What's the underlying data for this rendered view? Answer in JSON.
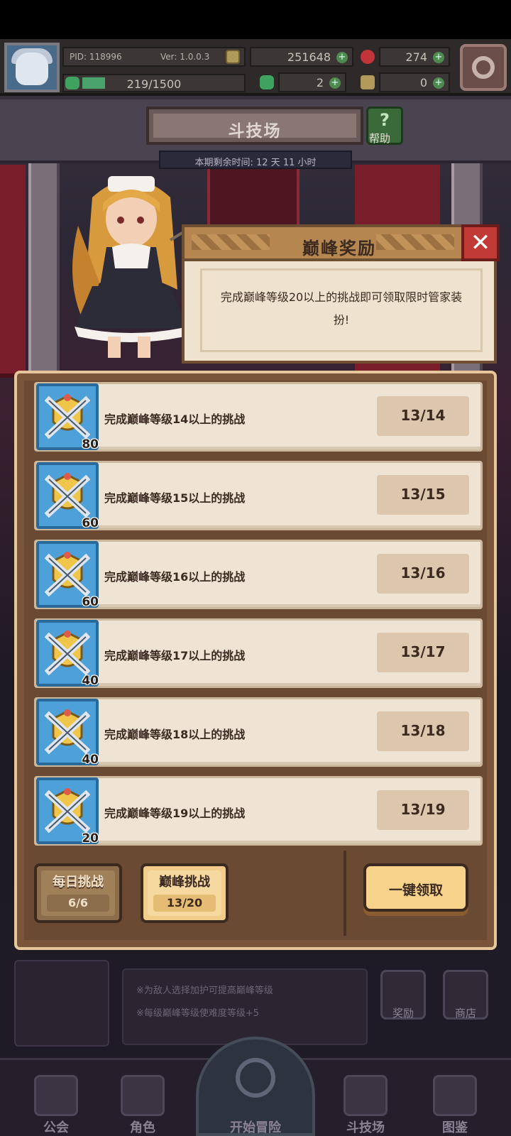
{
  "header": {
    "pid": "PID: 118996",
    "version": "Ver: 1.0.0.3",
    "gold": "251648",
    "gems": "274",
    "energy": "219/1500",
    "energy_fraction": 0.146,
    "clover_count": "2",
    "thumb_count": "0"
  },
  "arena": {
    "title": "斗技场",
    "help_label": "帮助",
    "timer": "本期剩余时间: 12 天 11 小时"
  },
  "peak_popup": {
    "title": "巅峰奖励",
    "description": "完成巅峰等级20以上的挑战即可领取限时管家装扮!"
  },
  "rewards": [
    {
      "text": "完成巅峰等级14以上的挑战",
      "progress": "13/14",
      "count": "80"
    },
    {
      "text": "完成巅峰等级15以上的挑战",
      "progress": "13/15",
      "count": "60"
    },
    {
      "text": "完成巅峰等级16以上的挑战",
      "progress": "13/16",
      "count": "60"
    },
    {
      "text": "完成巅峰等级17以上的挑战",
      "progress": "13/17",
      "count": "40"
    },
    {
      "text": "完成巅峰等级18以上的挑战",
      "progress": "13/18",
      "count": "40"
    },
    {
      "text": "完成巅峰等级19以上的挑战",
      "progress": "13/19",
      "count": "20"
    }
  ],
  "tabs": {
    "daily_label": "每日挑战",
    "daily_count": "6/6",
    "peak_label": "巅峰挑战",
    "peak_count": "13/20",
    "claim_all": "一键领取"
  },
  "notes": [
    "※为敌人选择加护可提高巅峰等级",
    "※每级巅峰等级使难度等级+5"
  ],
  "side_buttons": {
    "reward": "奖励",
    "shop": "商店"
  },
  "nav": {
    "guild": "公会",
    "character": "角色",
    "adventure": "开始冒险",
    "arena": "斗技场",
    "codex": "图鉴"
  },
  "colors": {
    "accent_gold": "#f6d28a",
    "close_red": "#c23a35",
    "icon_blue": "#4ea0d8"
  }
}
